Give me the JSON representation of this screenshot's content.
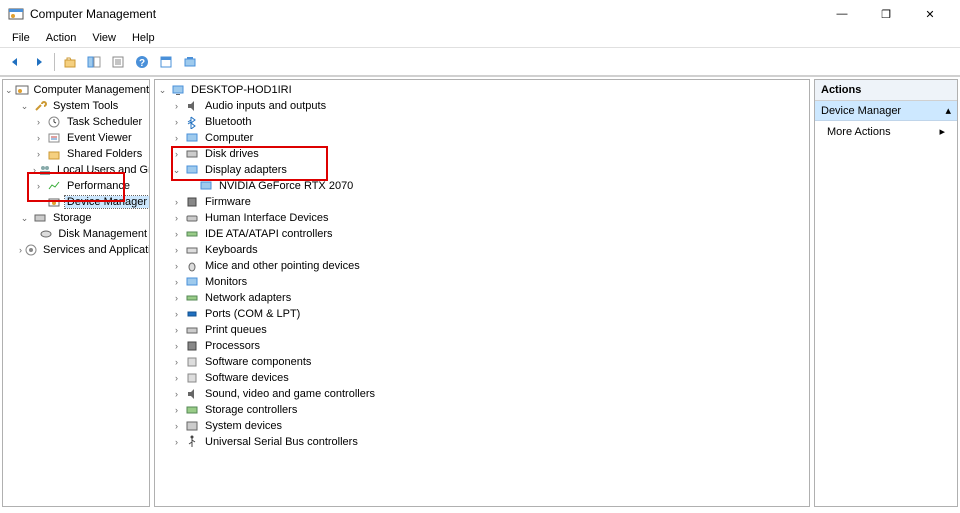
{
  "window": {
    "title": "Computer Management",
    "controls": {
      "minimize": "—",
      "maximize": "❐",
      "close": "✕"
    }
  },
  "menubar": {
    "items": [
      "File",
      "Action",
      "View",
      "Help"
    ]
  },
  "toolbar": {
    "buttons": [
      "back",
      "forward",
      "up",
      "show-hide-tree",
      "properties",
      "help",
      "refresh",
      "export"
    ]
  },
  "left_tree": {
    "root_label": "Computer Management (Local)",
    "system_tools": {
      "label": "System Tools",
      "children": [
        "Task Scheduler",
        "Event Viewer",
        "Shared Folders",
        "Local Users and Groups",
        "Performance",
        "Device Manager"
      ]
    },
    "storage": {
      "label": "Storage",
      "children": [
        "Disk Management"
      ]
    },
    "services": {
      "label": "Services and Applications"
    }
  },
  "center_tree": {
    "root": "DESKTOP-HOD1IRI",
    "categories": [
      {
        "label": "Audio inputs and outputs",
        "expanded": false
      },
      {
        "label": "Bluetooth",
        "expanded": false
      },
      {
        "label": "Computer",
        "expanded": false
      },
      {
        "label": "Disk drives",
        "expanded": false
      },
      {
        "label": "Display adapters",
        "expanded": true,
        "children": [
          "NVIDIA GeForce RTX 2070"
        ]
      },
      {
        "label": "Firmware",
        "expanded": false
      },
      {
        "label": "Human Interface Devices",
        "expanded": false
      },
      {
        "label": "IDE ATA/ATAPI controllers",
        "expanded": false
      },
      {
        "label": "Keyboards",
        "expanded": false
      },
      {
        "label": "Mice and other pointing devices",
        "expanded": false
      },
      {
        "label": "Monitors",
        "expanded": false
      },
      {
        "label": "Network adapters",
        "expanded": false
      },
      {
        "label": "Ports (COM & LPT)",
        "expanded": false
      },
      {
        "label": "Print queues",
        "expanded": false
      },
      {
        "label": "Processors",
        "expanded": false
      },
      {
        "label": "Software components",
        "expanded": false
      },
      {
        "label": "Software devices",
        "expanded": false
      },
      {
        "label": "Sound, video and game controllers",
        "expanded": false
      },
      {
        "label": "Storage controllers",
        "expanded": false
      },
      {
        "label": "System devices",
        "expanded": false
      },
      {
        "label": "Universal Serial Bus controllers",
        "expanded": false
      }
    ]
  },
  "actions": {
    "header": "Actions",
    "sub": "Device Manager",
    "more": "More Actions",
    "arrow_up": "▴",
    "arrow_right": "▸"
  },
  "glyphs": {
    "exp_open": "⌄",
    "exp_closed": "›"
  }
}
